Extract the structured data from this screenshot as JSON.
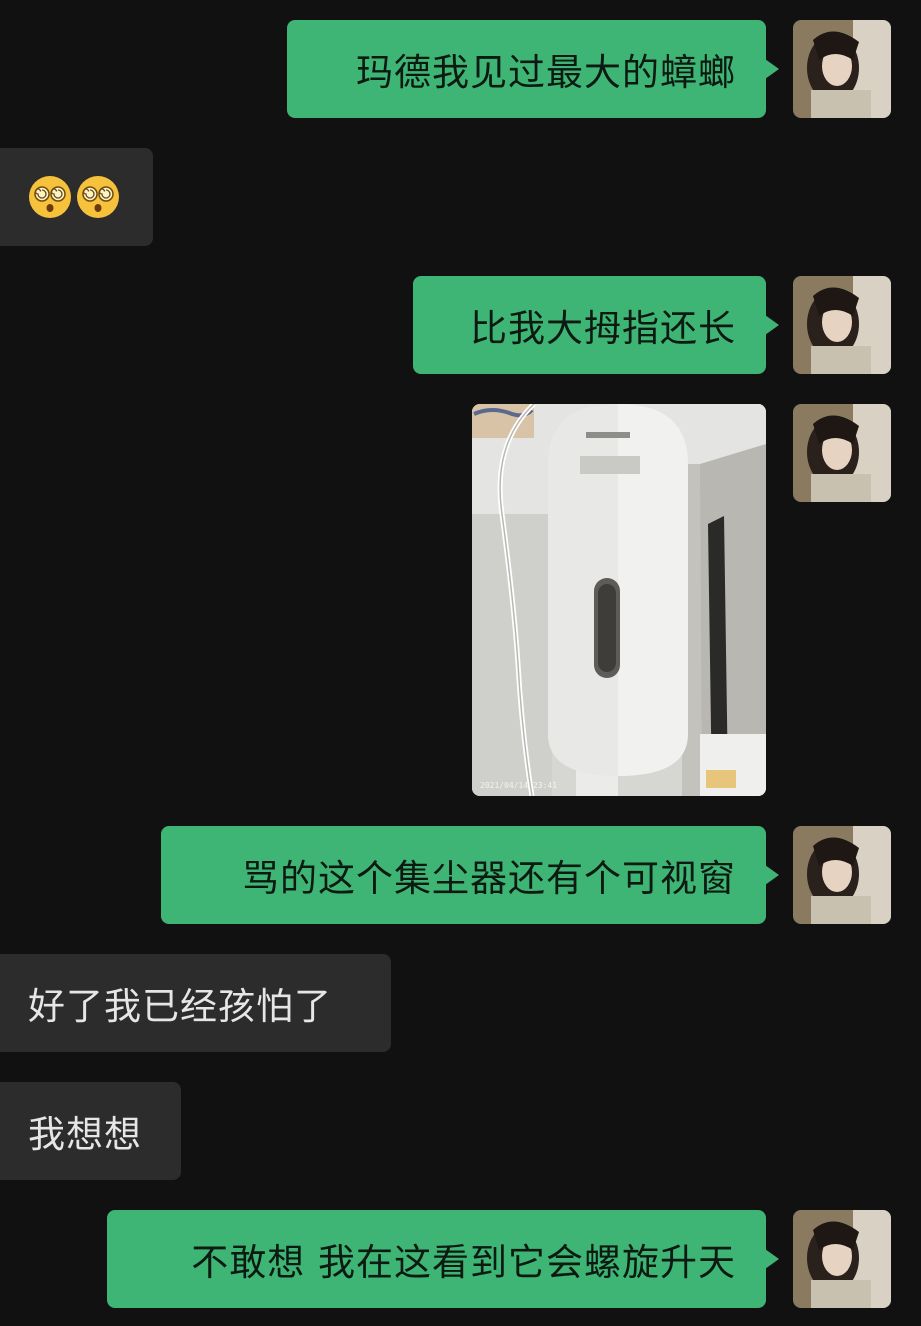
{
  "messages": [
    {
      "side": "sent",
      "text": "玛德我见过最大的蟑螂"
    },
    {
      "side": "recv",
      "emoji": [
        "dizzy-face-emoji",
        "dizzy-face-emoji"
      ]
    },
    {
      "side": "sent",
      "text": "比我大拇指还长"
    },
    {
      "side": "sent",
      "image": {
        "timestamp": "2021/04/14 23:41"
      }
    },
    {
      "side": "sent",
      "text": "骂的这个集尘器还有个可视窗"
    },
    {
      "side": "recv",
      "text": "好了我已经孩怕了"
    },
    {
      "side": "recv",
      "text": "我想想"
    },
    {
      "side": "sent",
      "text": "不敢想 我在这看到它会螺旋升天"
    }
  ],
  "colors": {
    "background": "#111111",
    "sent_bubble": "#3eb575",
    "received_bubble": "#2c2c2c",
    "received_text": "#e6e6e6"
  }
}
